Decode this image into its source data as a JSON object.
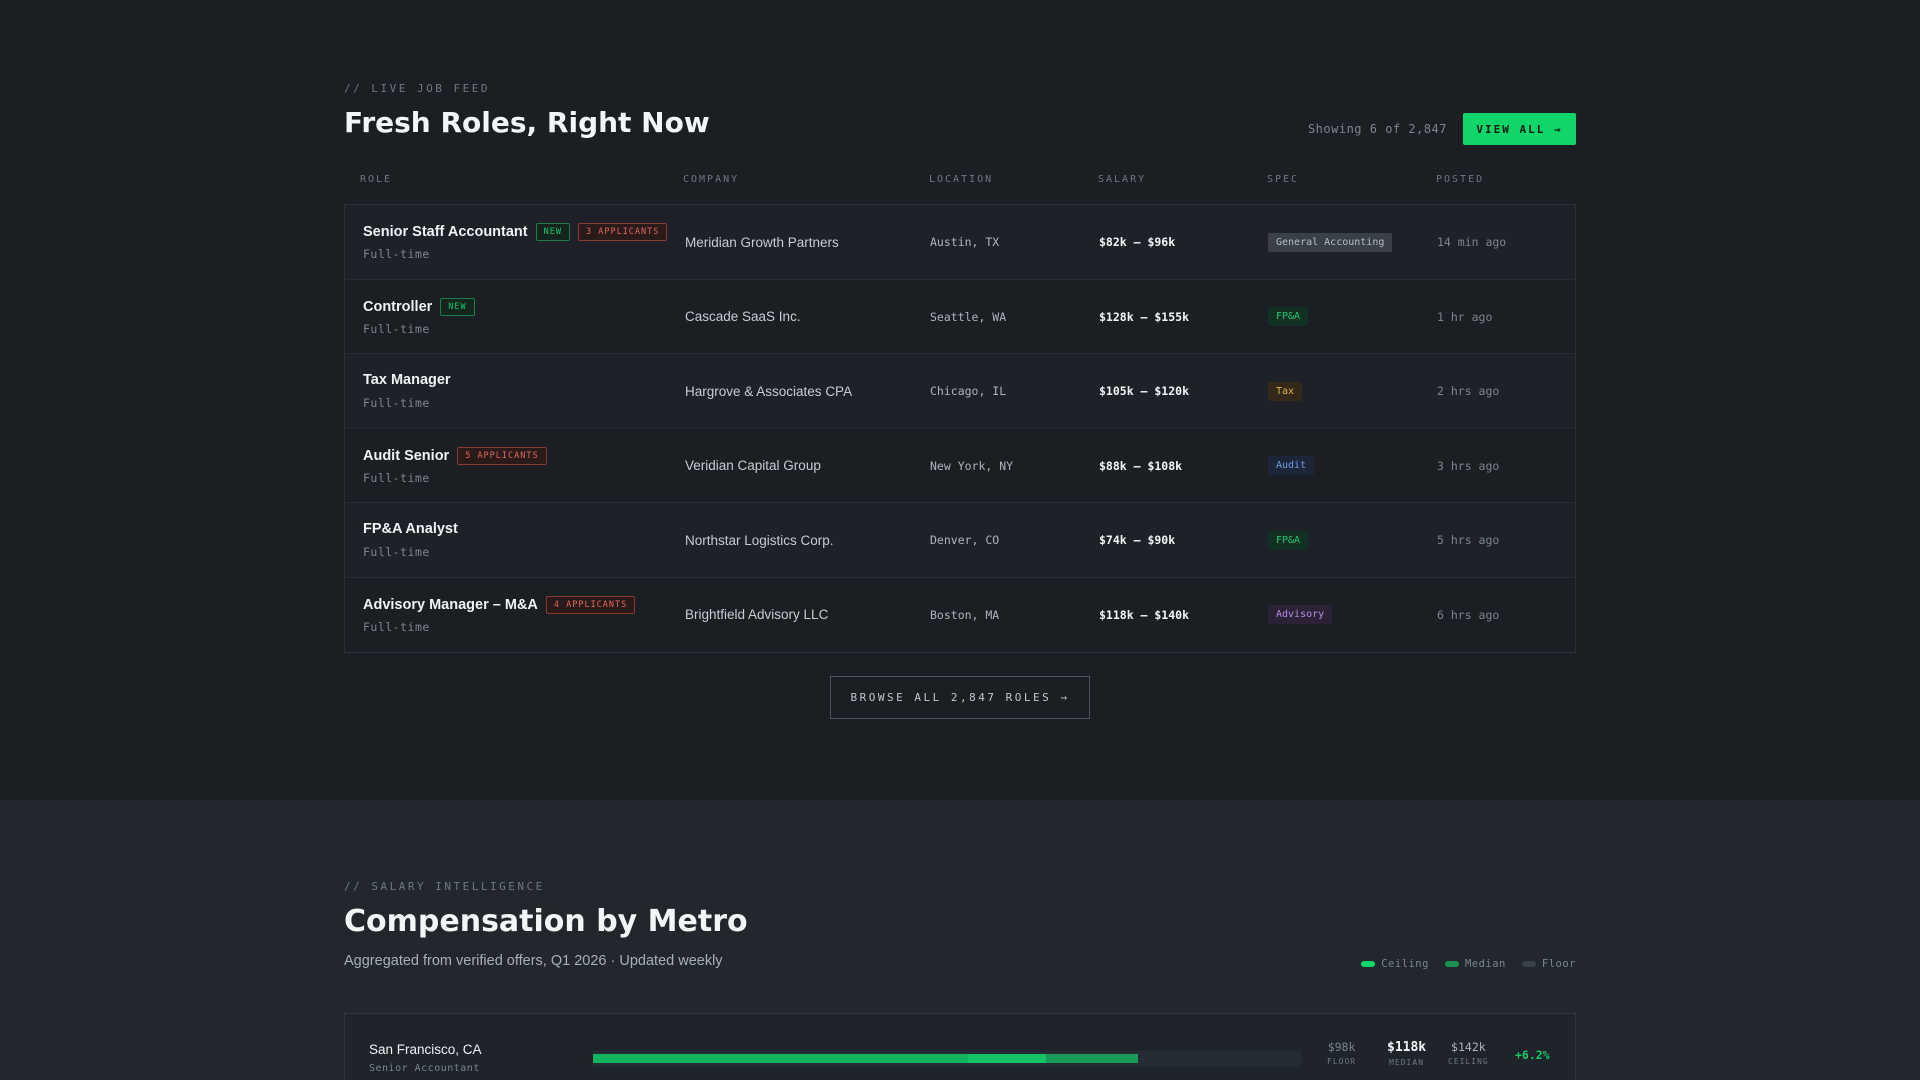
{
  "colors": {
    "accent": "#10d66a",
    "background": "#1b1f24",
    "positive": "#18c96a",
    "applicants": "#e06a5c"
  },
  "job_feed": {
    "eyebrow": "// LIVE JOB FEED",
    "title": "Fresh Roles, Right Now",
    "showing": "Showing 6 of 2,847",
    "view_all_label": "VIEW ALL →",
    "columns": [
      "ROLE",
      "COMPANY",
      "LOCATION",
      "SALARY",
      "SPEC",
      "POSTED"
    ],
    "rows": [
      {
        "role": "Senior Staff Accountant",
        "new_badge": "NEW",
        "applicants_badge": "3 APPLICANTS",
        "type": "Full-time",
        "company": "Meridian Growth Partners",
        "location": "Austin, TX",
        "salary": "$82k – $96k",
        "spec": "General Accounting",
        "posted": "14 min ago"
      },
      {
        "role": "Controller",
        "new_badge": "NEW",
        "applicants_badge": "",
        "type": "Full-time",
        "company": "Cascade SaaS Inc.",
        "location": "Seattle, WA",
        "salary": "$128k – $155k",
        "spec": "FP&A",
        "posted": "1 hr ago"
      },
      {
        "role": "Tax Manager",
        "new_badge": "",
        "applicants_badge": "",
        "type": "Full-time",
        "company": "Hargrove & Associates CPA",
        "location": "Chicago, IL",
        "salary": "$105k – $120k",
        "spec": "Tax",
        "posted": "2 hrs ago"
      },
      {
        "role": "Audit Senior",
        "new_badge": "",
        "applicants_badge": "5 APPLICANTS",
        "type": "Full-time",
        "company": "Veridian Capital Group",
        "location": "New York, NY",
        "salary": "$88k – $108k",
        "spec": "Audit",
        "posted": "3 hrs ago"
      },
      {
        "role": "FP&A Analyst",
        "new_badge": "",
        "applicants_badge": "",
        "type": "Full-time",
        "company": "Northstar Logistics Corp.",
        "location": "Denver, CO",
        "salary": "$74k – $90k",
        "spec": "FP&A",
        "posted": "5 hrs ago"
      },
      {
        "role": "Advisory Manager – M&A",
        "new_badge": "",
        "applicants_badge": "4 APPLICANTS",
        "type": "Full-time",
        "company": "Brightfield Advisory LLC",
        "location": "Boston, MA",
        "salary": "$118k – $140k",
        "spec": "Advisory",
        "posted": "6 hrs ago"
      }
    ],
    "browse_label": "BROWSE ALL 2,847 ROLES →"
  },
  "spec_styles": {
    "General Accounting": {
      "fg": "#b9bec4",
      "bg": "#3a4048"
    },
    "FP&A": {
      "fg": "#22c76f",
      "bg": "#143024"
    },
    "Tax": {
      "fg": "#e0b44a",
      "bg": "#33291a"
    },
    "Audit": {
      "fg": "#6f9fe6",
      "bg": "#1c2638"
    },
    "Advisory": {
      "fg": "#b58de0",
      "bg": "#2c2238"
    }
  },
  "salary_intel": {
    "eyebrow": "// SALARY INTELLIGENCE",
    "title": "Compensation by Metro",
    "subtitle": "Aggregated from verified offers, Q1 2026 · Updated weekly",
    "legend": [
      {
        "label": "Ceiling",
        "color": "#10d66a"
      },
      {
        "label": "Median",
        "color": "#1a8f52"
      },
      {
        "label": "Floor",
        "color": "#3a4048"
      }
    ],
    "metros": [
      {
        "city": "San Francisco, CA",
        "role": "Senior Accountant",
        "floor": "$98k",
        "median": "$118k",
        "ceiling": "$142k",
        "floor_label": "FLOOR",
        "median_label": "MEDIAN",
        "ceiling_label": "CEILING",
        "change": "+6.2%",
        "floor_fraction": 0.53,
        "median_fraction": 0.64,
        "ceiling_fraction": 0.77
      }
    ]
  }
}
